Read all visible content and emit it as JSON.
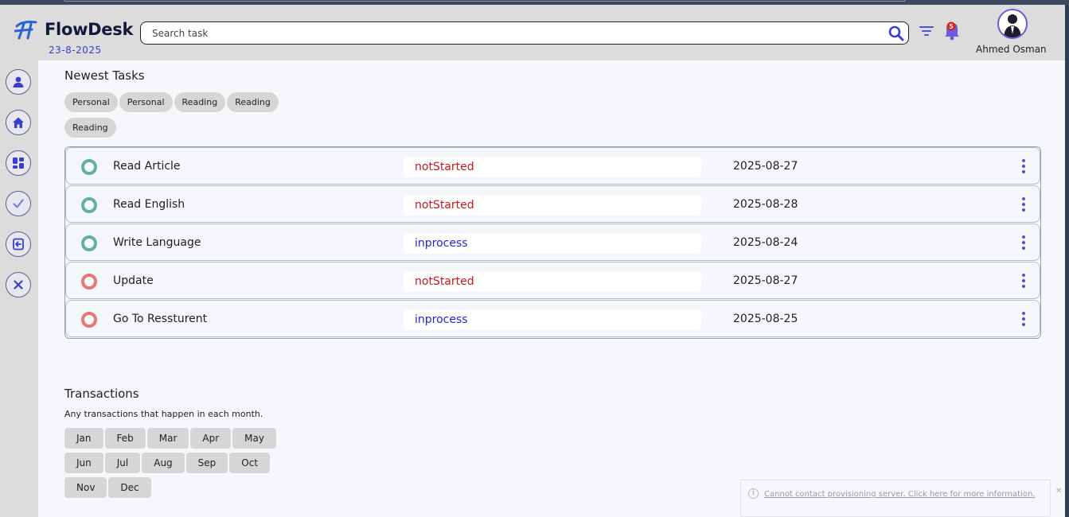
{
  "app": {
    "name": "FlowDesk",
    "date": "23-8-2025"
  },
  "search": {
    "placeholder": "Search task"
  },
  "user": {
    "name": "Ahmed Osman"
  },
  "notifications": {
    "badge": "5"
  },
  "sidebar": {
    "items": [
      {
        "icon": "user-icon"
      },
      {
        "icon": "home-icon"
      },
      {
        "icon": "dashboard-icon"
      },
      {
        "icon": "check-icon"
      },
      {
        "icon": "logout-icon"
      },
      {
        "icon": "close-icon"
      }
    ]
  },
  "tasks_section": {
    "title": "Newest Tasks",
    "chips": [
      "Personal",
      "Personal",
      "Reading",
      "Reading",
      "Reading"
    ],
    "rows": [
      {
        "name": "Read Article",
        "status": "notStarted",
        "date": "2025-08-27",
        "indicator": "green"
      },
      {
        "name": "Read English",
        "status": "notStarted",
        "date": "2025-08-28",
        "indicator": "green"
      },
      {
        "name": "Write Language",
        "status": "inprocess",
        "date": "2025-08-24",
        "indicator": "green"
      },
      {
        "name": "Update",
        "status": "notStarted",
        "date": "2025-08-27",
        "indicator": "red"
      },
      {
        "name": "Go To Ressturent",
        "status": "inprocess",
        "date": "2025-08-25",
        "indicator": "red"
      }
    ]
  },
  "transactions": {
    "title": "Transactions",
    "subtitle": "Any transactions that happen in each month.",
    "months": [
      "Jan",
      "Feb",
      "Mar",
      "Apr",
      "May",
      "Jun",
      "Jul",
      "Aug",
      "Sep",
      "Oct",
      "Nov",
      "Dec"
    ]
  },
  "notice": {
    "text": "Cannot contact provisioning server.  Click here for more information."
  },
  "colors": {
    "accent": "#5a4fc8",
    "not_started": "#c81818",
    "in_process": "#2424d0",
    "green": "#5fb59a",
    "red": "#e47a74"
  }
}
